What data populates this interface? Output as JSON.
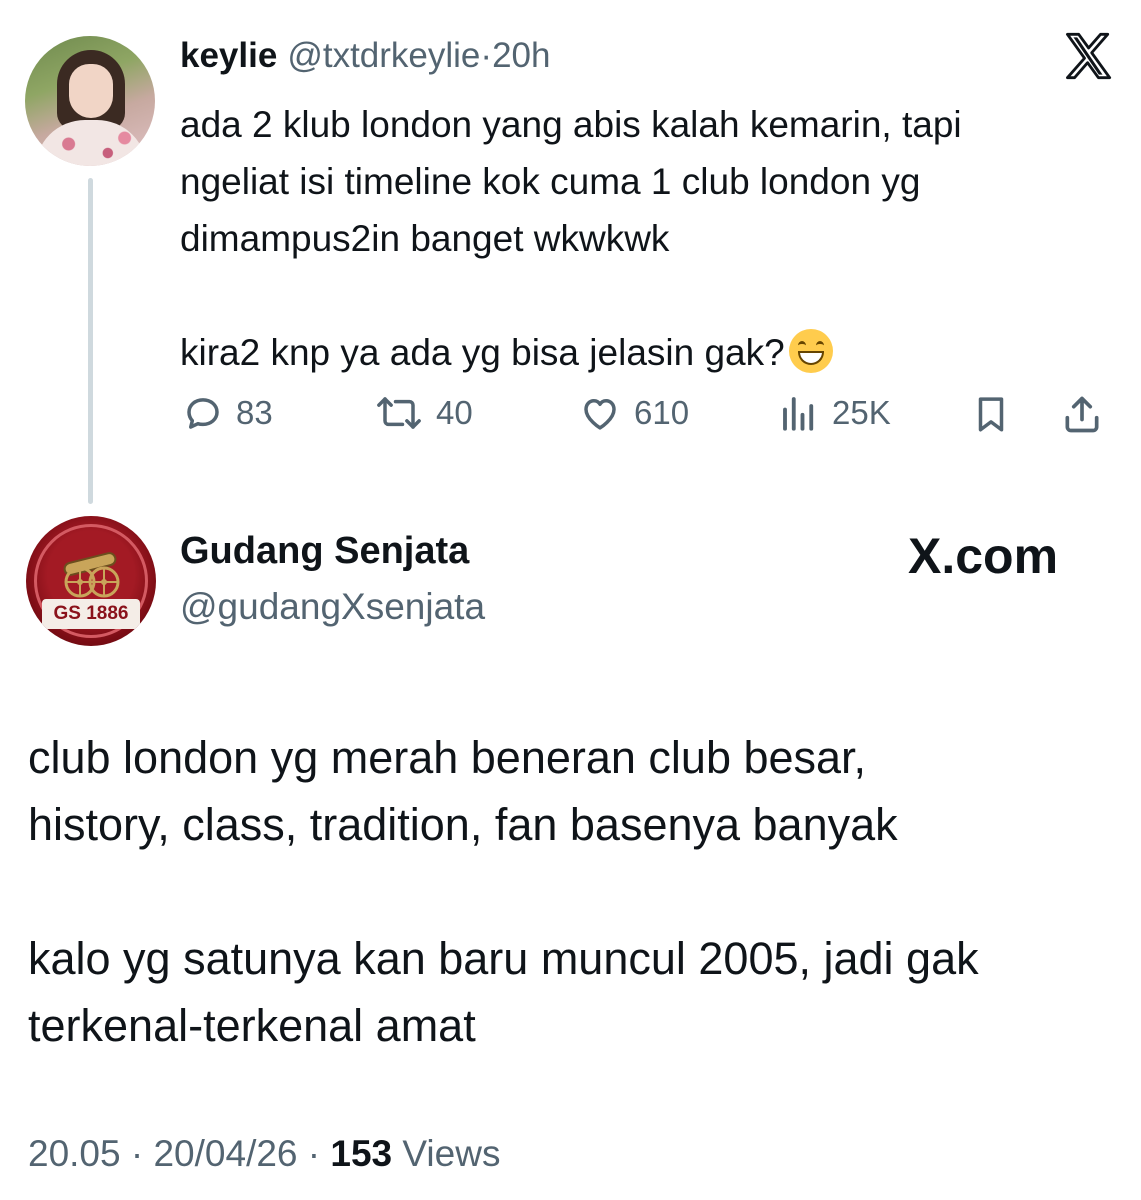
{
  "tweet1": {
    "display_name": "keylie",
    "handle": "@txtdrkeylie",
    "separator": "·",
    "time": "20h",
    "body_lines": [
      "ada 2 klub london yang abis kalah kemarin, tapi",
      "ngeliat isi timeline kok cuma 1 club london yg",
      "dimampus2in banget wkwkwk",
      "",
      "kira2 knp ya ada yg bisa jelasin gak?"
    ],
    "emoji": "grinning-face-emoji",
    "actions": {
      "replies": "83",
      "reposts": "40",
      "likes": "610",
      "views": "25K"
    },
    "icons": [
      "x-logo-icon",
      "reply-icon",
      "repost-icon",
      "like-icon",
      "views-icon",
      "bookmark-icon",
      "share-icon"
    ]
  },
  "tweet2": {
    "display_name": "Gudang Senjata",
    "handle": "@gudangXsenjata",
    "avatar_badge": "GS 1886",
    "brand": "X.com",
    "paragraph1_lines": [
      "club london yg merah beneran club besar,",
      "history, class, tradition, fan basenya banyak"
    ],
    "paragraph2_lines": [
      "kalo yg satunya kan baru muncul 2005, jadi gak",
      "terkenal-terkenal amat"
    ],
    "footer": {
      "time": "20.05",
      "date": "20/04/26",
      "views_count": "153",
      "views_label": "Views",
      "separator": "·"
    }
  },
  "colors": {
    "text": "#0f1419",
    "secondary": "#536471",
    "thread_line": "#cfd9de",
    "avatar_red": "#a31a24"
  }
}
